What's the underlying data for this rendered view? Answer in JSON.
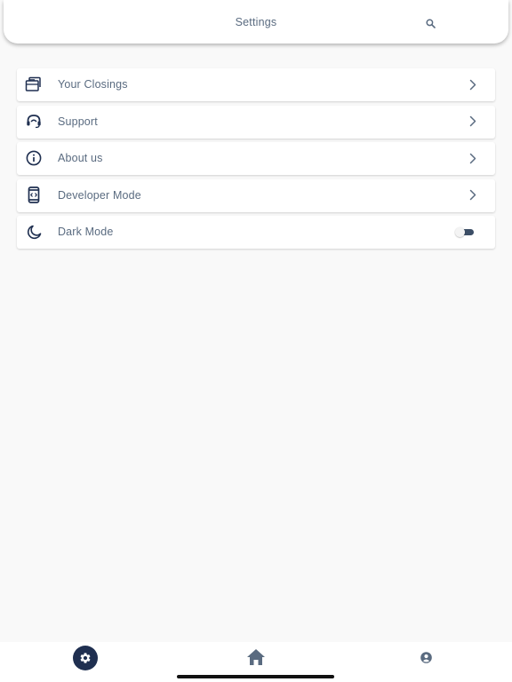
{
  "header": {
    "title": "Settings",
    "search_icon": "search-icon"
  },
  "settings": {
    "items": [
      {
        "label": "Your Closings",
        "icon": "briefcase-icon",
        "trailing": "chevron"
      },
      {
        "label": "Support",
        "icon": "headset-icon",
        "trailing": "chevron"
      },
      {
        "label": "About us",
        "icon": "info-icon",
        "trailing": "chevron"
      },
      {
        "label": "Developer Mode",
        "icon": "developer-phone-icon",
        "trailing": "chevron"
      },
      {
        "label": "Dark Mode",
        "icon": "moon-icon",
        "trailing": "toggle",
        "toggle_on": false
      }
    ]
  },
  "bottom_nav": {
    "items": [
      {
        "icon": "gear-icon",
        "active": true
      },
      {
        "icon": "home-icon",
        "active": false
      },
      {
        "icon": "account-icon",
        "active": false
      }
    ]
  },
  "colors": {
    "background": "#f9f9f9",
    "text": "#5a6b80",
    "icon": "#1f2f50",
    "active_nav": "#1f2f50"
  }
}
